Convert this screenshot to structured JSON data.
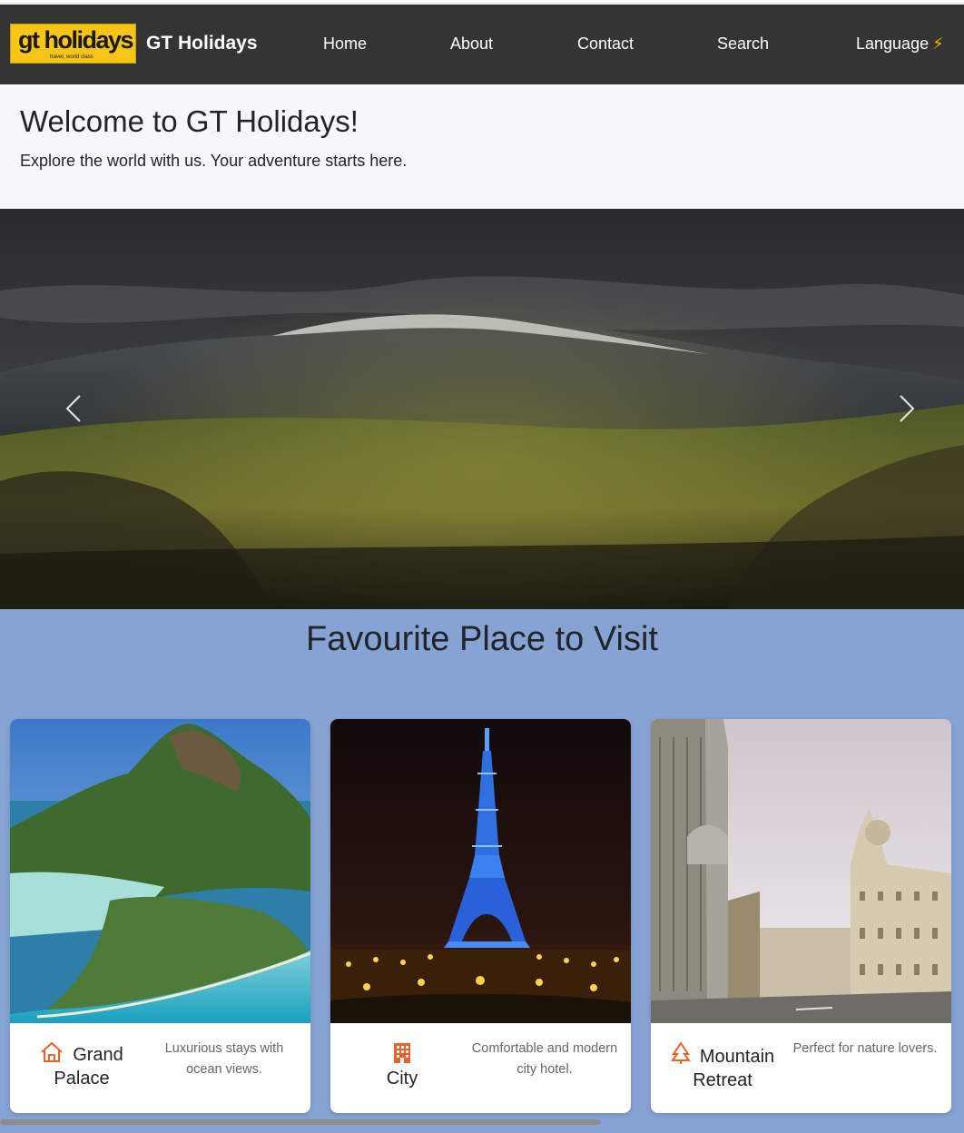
{
  "header": {
    "logo_text": "gt holidays",
    "logo_tagline": "travel, world class",
    "brand": "GT Holidays",
    "nav": {
      "home": "Home",
      "about": "About",
      "contact": "Contact",
      "search": "Search",
      "language": "Language"
    },
    "language_icon": "lightning-icon"
  },
  "welcome": {
    "title": "Welcome to GT Holidays!",
    "subtitle": "Explore the world with us. Your adventure starts here."
  },
  "carousel": {
    "prev_icon": "chevron-left-icon",
    "next_icon": "chevron-right-icon"
  },
  "places": {
    "heading": "Favourite Place to Visit",
    "cards": [
      {
        "title": "Grand Palace",
        "description": "Luxurious stays with ocean views.",
        "icon": "house-icon"
      },
      {
        "title": "City",
        "description": "Comfortable and modern city hotel.",
        "icon": "building-icon"
      },
      {
        "title": "Mountain Retreat",
        "description": "Perfect for nature lovers.",
        "icon": "tree-icon"
      }
    ]
  },
  "colors": {
    "navbar": "#343434",
    "logo_bg": "#f5c518",
    "accent_icon": "#e8622a",
    "section_bg": "#87a3d3"
  }
}
